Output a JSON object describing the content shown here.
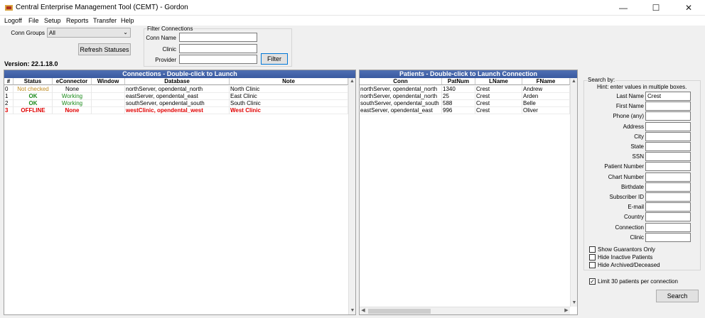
{
  "window": {
    "title": "Central Enterprise Management Tool (CEMT) - Gordon"
  },
  "menu": [
    "Logoff",
    "File",
    "Setup",
    "Reports",
    "Transfer",
    "Help"
  ],
  "conn_groups": {
    "label": "Conn Groups",
    "value": "All"
  },
  "refresh_label": "Refresh Statuses",
  "version": "Version: 22.1.18.0",
  "filter": {
    "legend": "Filter Connections",
    "conn_name_label": "Conn Name",
    "clinic_label": "Clinic",
    "provider_label": "Provider",
    "button": "Filter"
  },
  "connections": {
    "title": "Connections - Double-click to Launch",
    "columns": [
      "#",
      "Status",
      "eConnector",
      "Window",
      "Database",
      "Note"
    ],
    "rows": [
      {
        "num": "0",
        "status": "Not checked",
        "econnector": "None",
        "window": "",
        "database": "northServer, opendental_north",
        "note": "North Clinic",
        "kind": "nc"
      },
      {
        "num": "1",
        "status": "OK",
        "econnector": "Working",
        "window": "",
        "database": "eastServer, opendental_east",
        "note": "East Clinic",
        "kind": "ok"
      },
      {
        "num": "2",
        "status": "OK",
        "econnector": "Working",
        "window": "",
        "database": "southServer, opendental_south",
        "note": "South Clinic",
        "kind": "ok"
      },
      {
        "num": "3",
        "status": "OFFLINE",
        "econnector": "None",
        "window": "",
        "database": "westClinic, opendental_west",
        "note": "West Clinic",
        "kind": "off"
      }
    ]
  },
  "patients": {
    "title": "Patients - Double-click to Launch Connection",
    "columns": [
      "Conn",
      "PatNum",
      "LName",
      "FName"
    ],
    "rows": [
      {
        "conn": "northServer, opendental_north",
        "patnum": "1340",
        "lname": "Crest",
        "fname": "Andrew"
      },
      {
        "conn": "northServer, opendental_north",
        "patnum": "25",
        "lname": "Crest",
        "fname": "Arden"
      },
      {
        "conn": "southServer, opendental_south",
        "patnum": "588",
        "lname": "Crest",
        "fname": "Belle"
      },
      {
        "conn": "eastServer, opendental_east",
        "patnum": "996",
        "lname": "Crest",
        "fname": "Oliver"
      }
    ]
  },
  "search": {
    "legend": "Search by:",
    "hint": "Hint: enter values in multiple boxes.",
    "fields": [
      {
        "label": "Last Name",
        "value": "Crest"
      },
      {
        "label": "First Name",
        "value": ""
      },
      {
        "label": "Phone (any)",
        "value": ""
      },
      {
        "label": "Address",
        "value": ""
      },
      {
        "label": "City",
        "value": ""
      },
      {
        "label": "State",
        "value": ""
      },
      {
        "label": "SSN",
        "value": ""
      },
      {
        "label": "Patient Number",
        "value": ""
      },
      {
        "label": "Chart Number",
        "value": ""
      },
      {
        "label": "Birthdate",
        "value": ""
      },
      {
        "label": "Subscriber ID",
        "value": ""
      },
      {
        "label": "E-mail",
        "value": ""
      },
      {
        "label": "Country",
        "value": ""
      },
      {
        "label": "Connection",
        "value": ""
      },
      {
        "label": "Clinic",
        "value": ""
      }
    ],
    "checkboxes": [
      {
        "label": "Show Guarantors Only",
        "checked": false
      },
      {
        "label": "Hide Inactive Patients",
        "checked": false
      },
      {
        "label": "Hide Archived/Deceased",
        "checked": false
      }
    ],
    "limit": {
      "label": "Limit 30 patients per connection",
      "checked": true
    },
    "button": "Search"
  },
  "colors": {
    "grid_title_bg": "#3f5fa5",
    "ok": "#1a8a1a",
    "not_checked": "#c08a1e",
    "offline": "#e00000"
  }
}
